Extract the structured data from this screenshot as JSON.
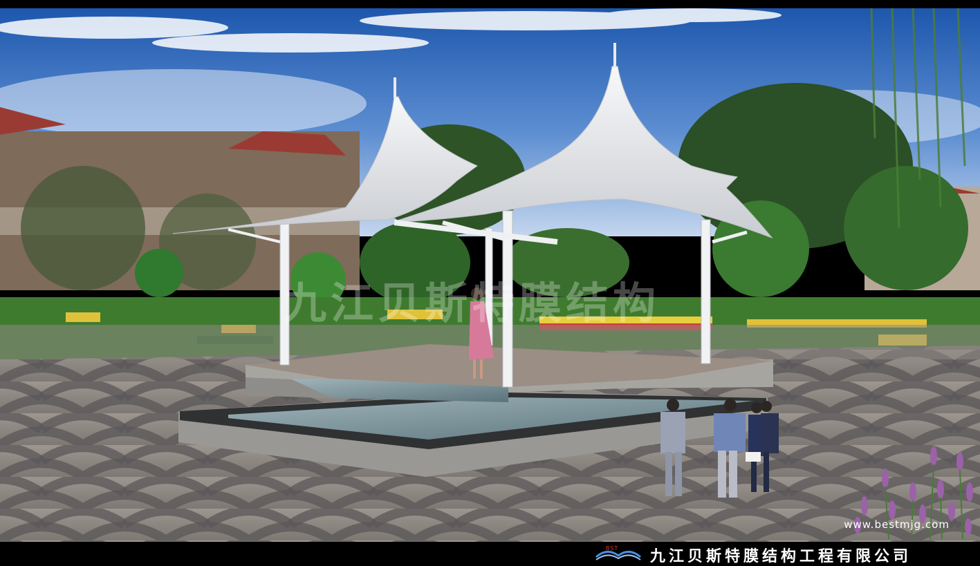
{
  "watermark": "九江贝斯特膜结构",
  "website": "www.bestmjg.com",
  "company_name": "九江贝斯特膜结构工程有限公司",
  "logo_mark": "BST",
  "colors": {
    "sky_top": "#1f5fb8",
    "sky_bottom": "#a9c6ea",
    "membrane": "#eef0f2",
    "paving": "#8a8580",
    "paving_dark": "#4a4a4c",
    "foliage": "#2f6b2a",
    "water": "#6f8c96",
    "bar": "#000000"
  },
  "scene": {
    "subject": "white double-peak tensile membrane canopy pavilion over water feature",
    "icons": [
      "membrane-canopy",
      "steel-column",
      "reflecting-pool",
      "visitor-figures",
      "trees",
      "flower-beds",
      "lavender-flowers",
      "paved-plaza"
    ]
  }
}
